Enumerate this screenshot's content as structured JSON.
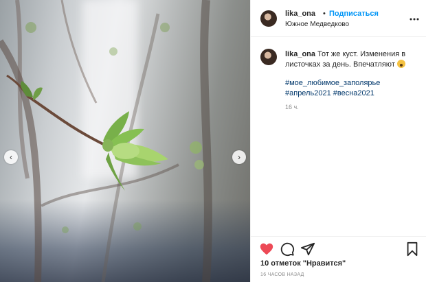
{
  "post": {
    "username": "lika_ona",
    "dot": "•",
    "follow_label": "Подписаться",
    "location": "Южное Медведково",
    "more_icon": "more-options-icon",
    "caption": {
      "username": "lika_ona",
      "text": "Тот же куст. Изменения в листочках за день. Впечатляют",
      "emoji": "astonished-face-emoji",
      "hashtags_line1": "#мое_любимое_заполярье",
      "hashtags_line2": "#апрель2021 #весна2021",
      "age": "16 ч."
    },
    "photo": {
      "prev_arrow": "‹",
      "next_arrow": "›"
    },
    "actions": {
      "like_icon": "heart-icon",
      "comment_icon": "comment-icon",
      "share_icon": "share-icon",
      "save_icon": "bookmark-icon",
      "like_color": "#ed4956"
    },
    "likes_text": "10 отметок \"Нравится\"",
    "timestamp": "16 ЧАСОВ НАЗАД"
  }
}
